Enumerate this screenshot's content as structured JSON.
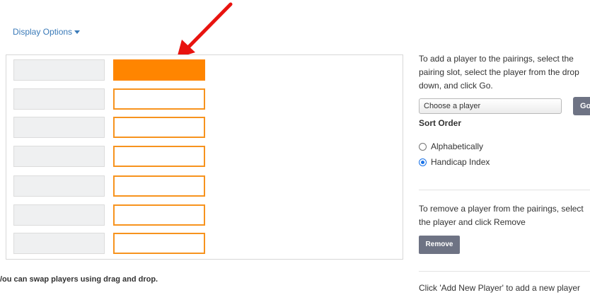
{
  "display_options": {
    "label": "Display Options"
  },
  "pairings": {
    "rows": [
      {
        "left": "",
        "right": "",
        "selected": true
      },
      {
        "left": "",
        "right": "",
        "selected": false
      },
      {
        "left": "",
        "right": "",
        "selected": false
      },
      {
        "left": "",
        "right": "",
        "selected": false
      },
      {
        "left": "",
        "right": "",
        "selected": false
      },
      {
        "left": "",
        "right": "",
        "selected": false
      },
      {
        "left": "",
        "right": "",
        "selected": false
      }
    ],
    "swap_note": "/ou can swap players using drag and drop."
  },
  "side": {
    "add_instructions": "To add a player to the pairings, select the pairing slot, select the player from the drop down, and click Go.",
    "player_select": "Choose a player",
    "go_label": "Go",
    "sort_title": "Sort Order",
    "sort_options": [
      {
        "label": "Alphabetically",
        "checked": false
      },
      {
        "label": "Handicap Index",
        "checked": true
      }
    ],
    "remove_instructions": "To remove a player from the pairings, select the player and click Remove",
    "remove_label": "Remove",
    "new_player_instructions": "Click 'Add New Player' to add a new player"
  },
  "colors": {
    "selected_slot": "#ff8500",
    "slot_border": "#f7931e",
    "arrow": "#e8130f",
    "button": "#6e7384",
    "link": "#3a7ab8"
  },
  "icons": {
    "arrow": "red-arrow-icon",
    "caret": "caret-down-icon"
  }
}
